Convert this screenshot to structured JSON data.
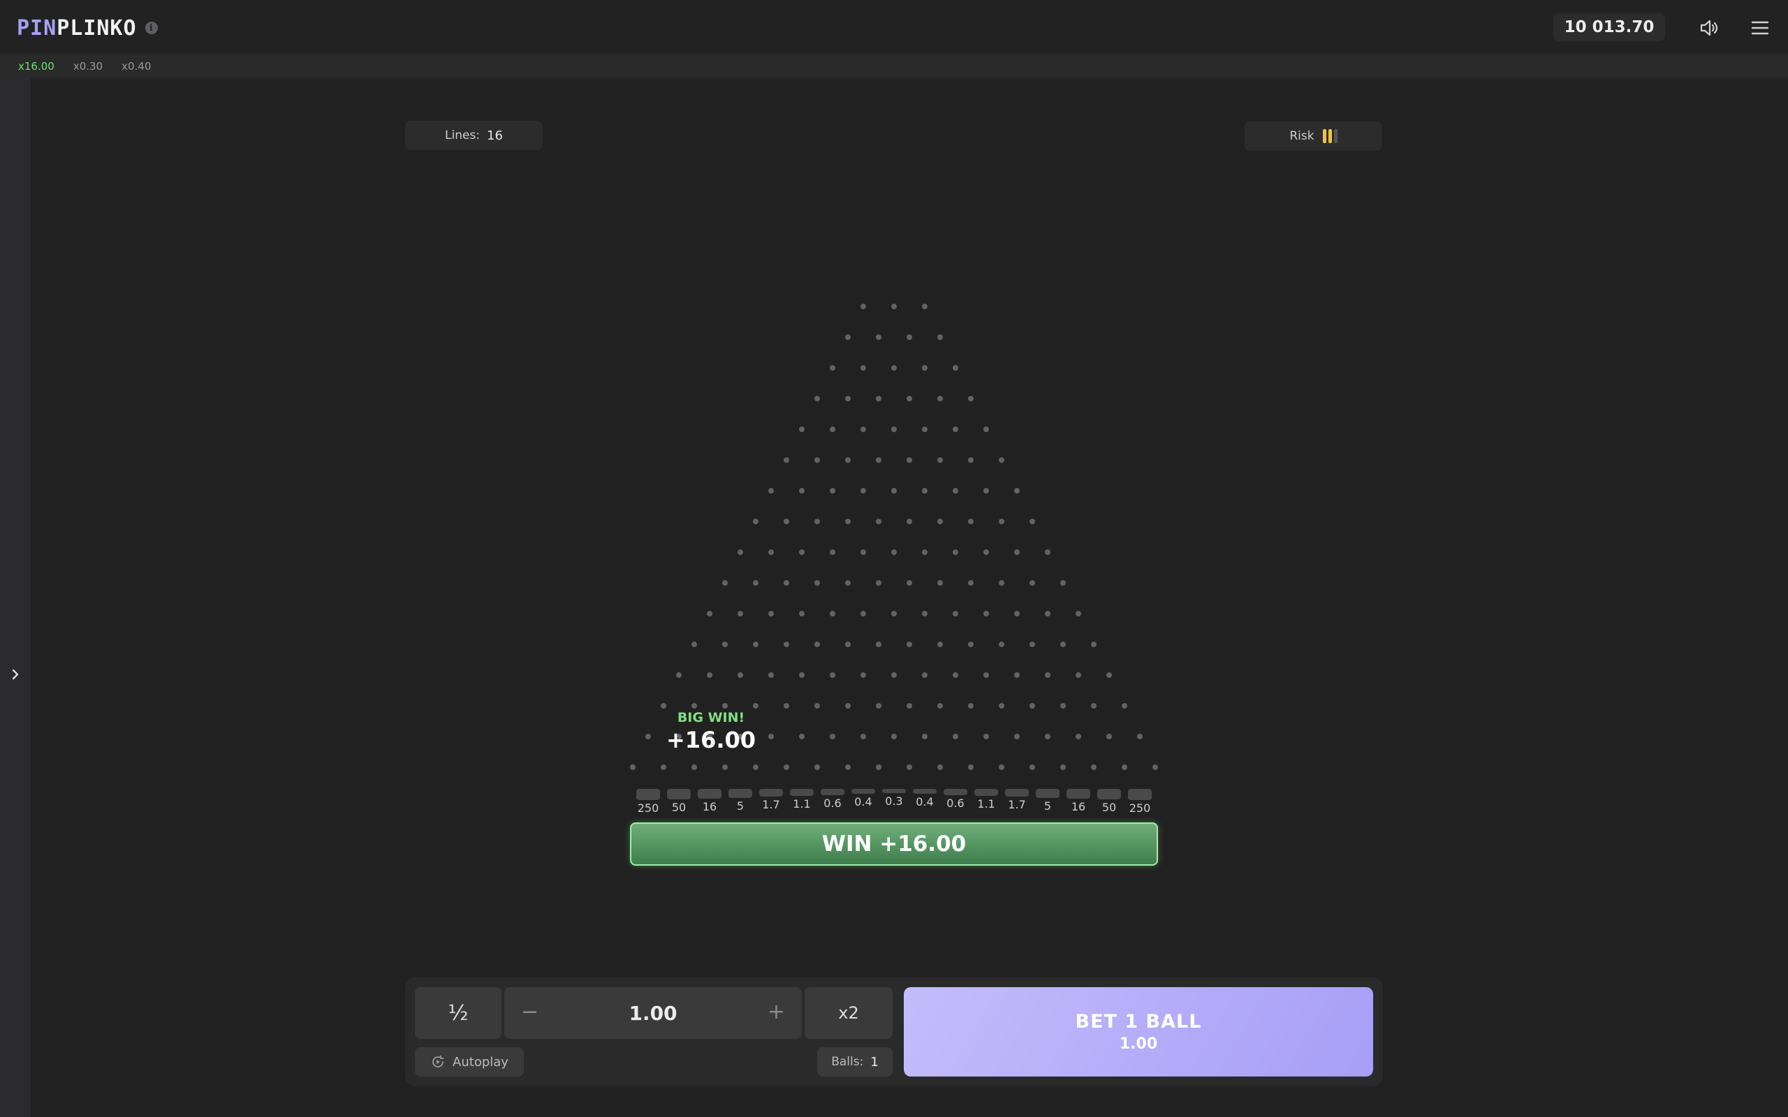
{
  "header": {
    "logo_pin": "PIN",
    "logo_plinko": "PLINKO",
    "info_icon": "i",
    "balance": "10 013.70",
    "sound_icon": "speaker-icon",
    "menu_icon": "hamburger-icon"
  },
  "history": [
    "x16.00",
    "x0.30",
    "x0.40"
  ],
  "controls": {
    "lines_label": "Lines:",
    "lines_value": "16",
    "risk_label": "Risk",
    "risk_level": 2,
    "risk_max": 3
  },
  "board": {
    "rows": 16,
    "multipliers": [
      "250",
      "50",
      "16",
      "5",
      "1.7",
      "1.1",
      "0.6",
      "0.4",
      "0.3",
      "0.4",
      "0.6",
      "1.1",
      "1.7",
      "5",
      "16",
      "50",
      "250"
    ]
  },
  "result": {
    "big_win_label": "BIG WIN!",
    "big_win_amount": "+16.00",
    "win_bar": "WIN +16.00"
  },
  "bet_panel": {
    "half_label": "½",
    "minus": "−",
    "plus": "+",
    "amount": "1.00",
    "x2_label": "x2",
    "autoplay_label": "Autoplay",
    "balls_label": "Balls:",
    "balls_value": "1",
    "bet_label": "BET 1 BALL",
    "bet_amount": "1.00"
  },
  "colors": {
    "accent_purple": "#a9a0f5",
    "win_green": "#6ee072",
    "risk_yellow": "#f5c431"
  }
}
